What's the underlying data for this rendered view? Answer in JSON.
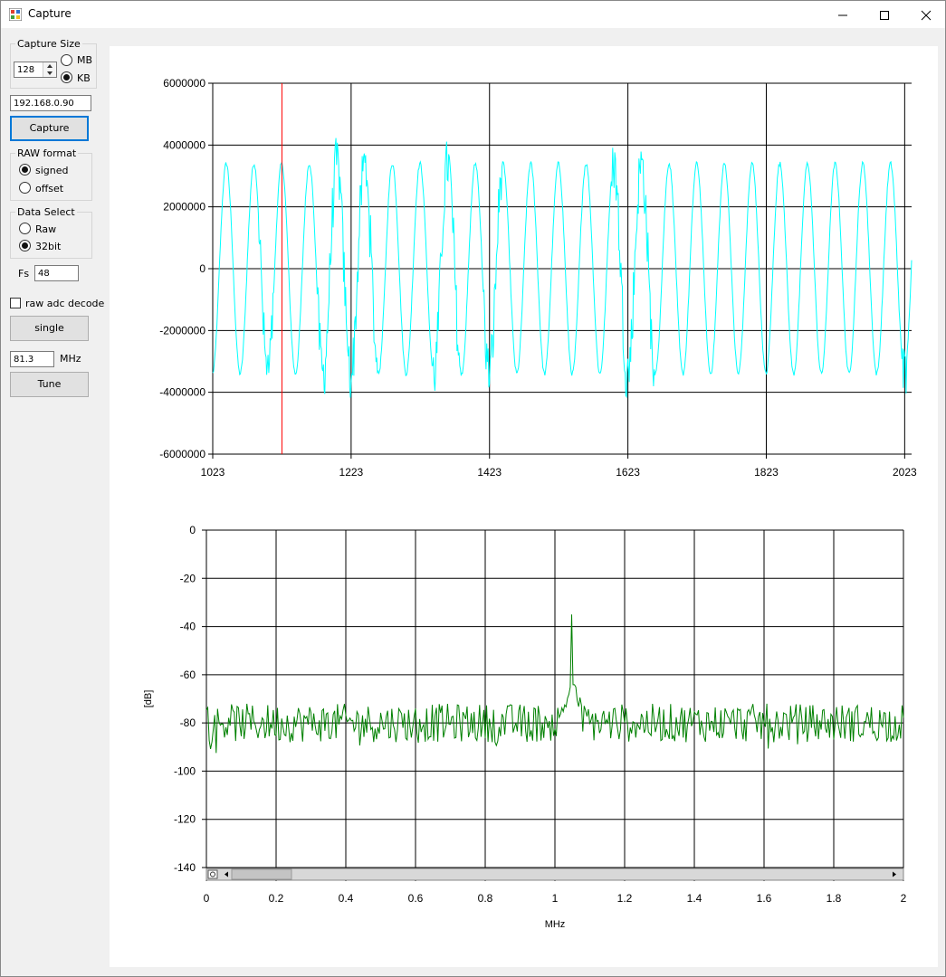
{
  "window": {
    "title": "Capture",
    "minimize_icon": "minimize-icon",
    "maximize_icon": "maximize-icon",
    "close_icon": "close-icon"
  },
  "sidebar": {
    "capture_size": {
      "label": "Capture Size",
      "value": "128",
      "unit_mb": "MB",
      "unit_kb": "KB",
      "selected": "KB"
    },
    "ip_address": "192.168.0.90",
    "capture_button": "Capture",
    "raw_format": {
      "label": "RAW format",
      "signed": "signed",
      "offset": "offset",
      "selected": "signed"
    },
    "data_select": {
      "label": "Data Select",
      "raw": "Raw",
      "bit32": "32bit",
      "selected": "32bit"
    },
    "fs_label": "Fs",
    "fs_value": "48",
    "raw_adc_decode": {
      "label": "raw adc decode",
      "checked": false
    },
    "single_button": "single",
    "freq_value": "81.3",
    "freq_unit": "MHz",
    "tune_button": "Tune"
  },
  "chart_data": [
    {
      "type": "line",
      "title": "",
      "xlabel": "",
      "ylabel": "",
      "xlim": [
        1023,
        2033
      ],
      "ylim": [
        -6000000,
        6000000
      ],
      "x_ticks": [
        "1023",
        "1223",
        "1423",
        "1623",
        "1823",
        "2023"
      ],
      "y_ticks": [
        "6000000",
        "4000000",
        "2000000",
        "0",
        "-2000000",
        "-4000000",
        "-6000000"
      ],
      "grid": true,
      "series": [
        {
          "color": "#00ffff",
          "shape": "sinusoid",
          "period_samples": 40,
          "amplitude": 3400000,
          "x_range": [
            1023,
            2033
          ]
        }
      ],
      "marker_line": {
        "x": 1123,
        "color": "#ff0000"
      }
    },
    {
      "type": "line",
      "title": "",
      "xlabel": "MHz",
      "ylabel": "[dB]",
      "xlim": [
        0,
        2
      ],
      "ylim": [
        -140,
        0
      ],
      "x_ticks": [
        "0",
        "0.2",
        "0.4",
        "0.6",
        "0.8",
        "1",
        "1.2",
        "1.4",
        "1.6",
        "1.8",
        "2"
      ],
      "y_ticks": [
        "0",
        "-20",
        "-40",
        "-60",
        "-80",
        "-100",
        "-120",
        "-140"
      ],
      "grid": true,
      "series": [
        {
          "color": "#008000",
          "noise_floor_db": -80,
          "peak": {
            "x": 1.05,
            "y": -35
          }
        }
      ],
      "scrollbar": true
    }
  ]
}
